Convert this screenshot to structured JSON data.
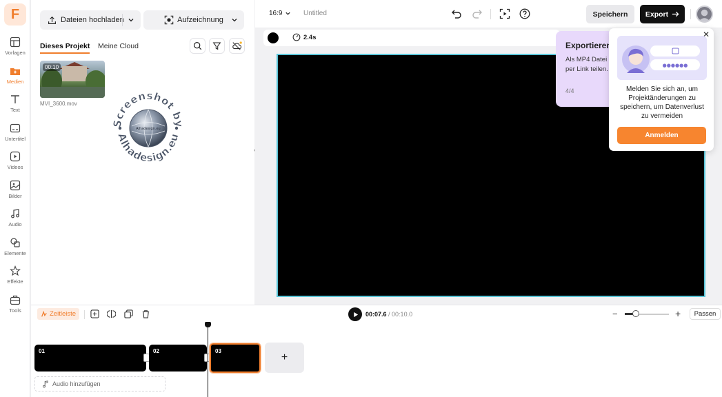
{
  "app": {
    "logo_letter": "F",
    "accent": "#f07d2c"
  },
  "sidebar": {
    "items": [
      {
        "label": "Vorlagen",
        "icon": "templates-icon"
      },
      {
        "label": "Medien",
        "icon": "media-icon",
        "active": true
      },
      {
        "label": "Text",
        "icon": "text-icon"
      },
      {
        "label": "Untertitel",
        "icon": "subtitles-icon"
      },
      {
        "label": "Videos",
        "icon": "videos-icon"
      },
      {
        "label": "Bilder",
        "icon": "images-icon"
      },
      {
        "label": "Audio",
        "icon": "audio-icon"
      },
      {
        "label": "Elemente",
        "icon": "elements-icon"
      },
      {
        "label": "Effekte",
        "icon": "effects-icon"
      },
      {
        "label": "Tools",
        "icon": "tools-icon"
      }
    ]
  },
  "media_panel": {
    "upload_label": "Dateien hochladen",
    "record_label": "Aufzeichnung",
    "tabs": [
      {
        "label": "Dieses Projekt",
        "active": true
      },
      {
        "label": "Meine Cloud"
      }
    ],
    "files": [
      {
        "name": "MVI_3600.mov",
        "duration": "00:10"
      }
    ],
    "watermark": {
      "top_text": "Screenshot by",
      "bottom_text": "Alhadesign.eu",
      "center_text": "Alhadesign.eu"
    }
  },
  "topbar": {
    "aspect_ratio": "16:9",
    "project_title": "Untitled",
    "save_label": "Speichern",
    "export_label": "Export"
  },
  "canvas_toolbar": {
    "duration": "2.4s",
    "background_color": "#000000"
  },
  "tour_tooltip": {
    "title": "Exportieren (",
    "body": "Als MP4 Datei o per Link teilen.",
    "step": "4/4"
  },
  "login_popup": {
    "message": "Melden Sie sich an, um Projektänderungen zu speichern, um Datenverlust zu vermeiden",
    "button_label": "Anmelden"
  },
  "timeline": {
    "label": "Zeitleiste",
    "current_time": "00:07.6",
    "separator": " / ",
    "total_time": "00:10.0",
    "fit_label": "Passen",
    "zoom_level": 0.25,
    "clips": [
      {
        "label": "01"
      },
      {
        "label": "02"
      },
      {
        "label": "03",
        "selected": true
      }
    ],
    "add_clip_symbol": "+",
    "audio_add_label": "Audio hinzufügen"
  }
}
